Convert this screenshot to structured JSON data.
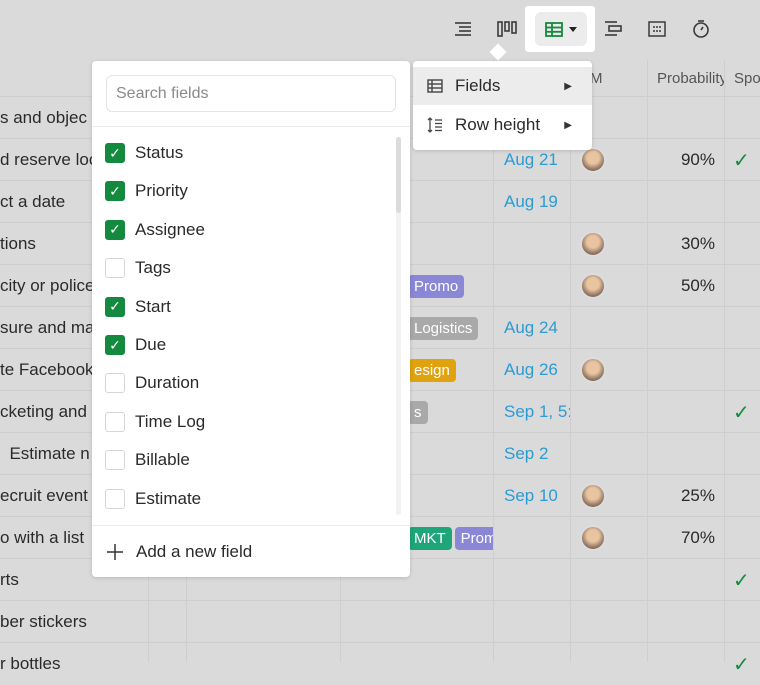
{
  "toolbar": {
    "icons": [
      "list-icon",
      "board-icon",
      "table-icon",
      "gantt-icon",
      "calendar-icon",
      "stopwatch-icon"
    ],
    "active_view": "table",
    "accent": "#138a3d"
  },
  "columns": {
    "pm": "PM",
    "probability": "Probability",
    "sponsor": "Spo"
  },
  "rows": [
    {
      "title": "s and objec"
    },
    {
      "title": "d reserve loc",
      "due": "Aug 21",
      "avatar": true,
      "prob": "90%",
      "check": true
    },
    {
      "title": "ct a date",
      "due": "Aug 19"
    },
    {
      "title": "tions",
      "avatar": true,
      "prob": "30%"
    },
    {
      "title": "city or police",
      "tags": [
        {
          "label": "Promo",
          "color": "#8a87d6"
        }
      ],
      "avatar": true,
      "prob": "50%"
    },
    {
      "title": "sure and ma",
      "tags": [
        {
          "label": "Logistics",
          "color": "#a9a9a9"
        }
      ],
      "due": "Aug 24"
    },
    {
      "title": "te Facebook",
      "tags": [
        {
          "label": "esign",
          "color": "#e0a20f"
        }
      ],
      "due": "Aug 26",
      "avatar": true
    },
    {
      "title": "cketing and",
      "tags": [
        {
          "label": "s",
          "color": "#a9a9a9"
        }
      ],
      "due": "Sep 1, 5:",
      "check": true
    },
    {
      "title": "  Estimate n",
      "due": "Sep 2"
    },
    {
      "title": "ecruit event",
      "due": "Sep 10",
      "avatar": true,
      "prob": "25%"
    },
    {
      "title": "o with a list",
      "tags": [
        {
          "label": "MKT",
          "color": "#1fa57a"
        },
        {
          "label": "Prom",
          "color": "#8a87d6"
        }
      ],
      "avatar": true,
      "prob": "70%"
    },
    {
      "title": "rts",
      "check": true
    },
    {
      "title": "ber stickers"
    },
    {
      "title": "r bottles",
      "check": true
    }
  ],
  "fields_panel": {
    "search_placeholder": "Search fields",
    "fields": [
      {
        "label": "Status",
        "checked": true
      },
      {
        "label": "Priority",
        "checked": true
      },
      {
        "label": "Assignee",
        "checked": true
      },
      {
        "label": "Tags",
        "checked": false
      },
      {
        "label": "Start",
        "checked": true
      },
      {
        "label": "Due",
        "checked": true
      },
      {
        "label": "Duration",
        "checked": false
      },
      {
        "label": "Time Log",
        "checked": false
      },
      {
        "label": "Billable",
        "checked": false
      },
      {
        "label": "Estimate",
        "checked": false
      }
    ],
    "add_label": "Add a new field"
  },
  "submenu": {
    "fields": "Fields",
    "row_height": "Row height"
  }
}
